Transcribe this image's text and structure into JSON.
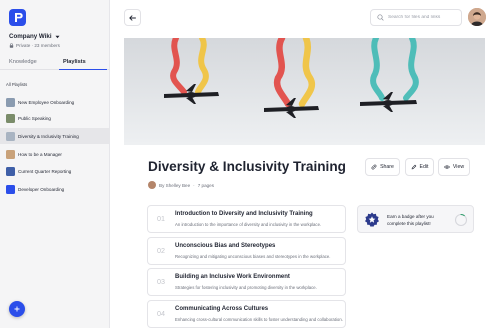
{
  "sidebar": {
    "workspace_name": "Company Wiki",
    "workspace_meta": "Private · 23 members",
    "tabs": [
      {
        "label": "Knowledge"
      },
      {
        "label": "Playlists"
      }
    ],
    "section_label": "All Playlists",
    "items": [
      {
        "label": "New Employee Onboarding",
        "thumb_color": "#8a9bb0"
      },
      {
        "label": "Public Speaking",
        "thumb_color": "#7a8c6a"
      },
      {
        "label": "Diversity & Inclusivity Training",
        "thumb_color": "#a9b4c2"
      },
      {
        "label": "How to be a Manager",
        "thumb_color": "#c9a27a"
      },
      {
        "label": "Current Quarter Reporting",
        "thumb_color": "#3f5fa8"
      },
      {
        "label": "Developer Onboarding",
        "thumb_color": "#2b4eea"
      }
    ]
  },
  "header": {
    "search_placeholder": "Search for files and links"
  },
  "playlist": {
    "title": "Diversity & Inclusivity Training",
    "author": "By Shelley Bee",
    "separator": "·",
    "pages": "7 pages",
    "actions": {
      "share": "Share",
      "edit": "Edit",
      "view": "View"
    },
    "lessons": [
      {
        "num": "01",
        "title": "Introduction to Diversity and Inclusivity Training",
        "desc": "An introduction to the importance of diversity and inclusivity in the workplace."
      },
      {
        "num": "02",
        "title": "Unconscious Bias and Stereotypes",
        "desc": "Recognizing and mitigating unconscious biases and stereotypes in the workplace."
      },
      {
        "num": "03",
        "title": "Building an Inclusive Work Environment",
        "desc": "Strategies for fostering inclusivity and promoting diversity in the workplace."
      },
      {
        "num": "04",
        "title": "Communicating Across Cultures",
        "desc": "Enhancing cross-cultural communication skills to foster understanding and collaboration."
      }
    ],
    "badge_text": "Earn a badge after you complete this playlist!",
    "progress": 0.1
  },
  "colors": {
    "accent": "#2b4eea",
    "smoke_red": "#e2453f",
    "smoke_yellow": "#f2c238",
    "smoke_teal": "#3fb9b4"
  }
}
